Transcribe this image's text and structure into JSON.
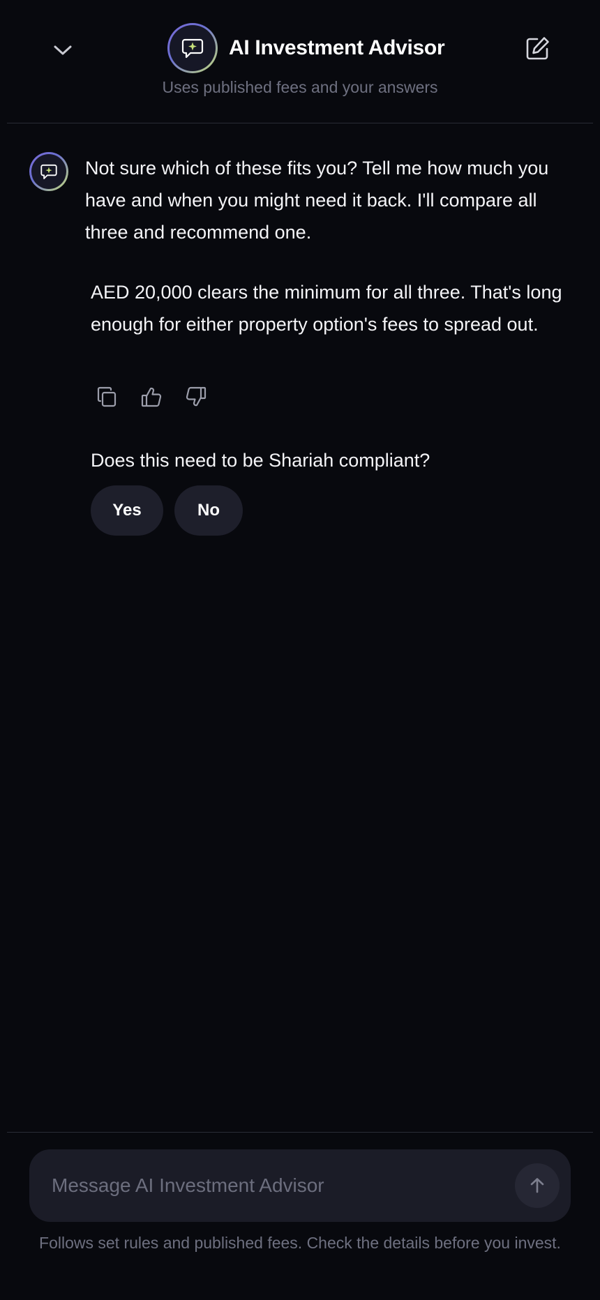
{
  "header": {
    "title": "AI Investment Advisor",
    "subtitle": "Uses published fees and your answers",
    "collapse_icon": "chevron-down-icon",
    "edit_icon": "edit-icon",
    "avatar_icon": "chat-sparkle-icon"
  },
  "messages": {
    "intro": "Not sure which of these fits you? Tell me how much you have and when you might need it back. I'll compare all three and recommend one.",
    "reply": "AED 20,000 clears the minimum for all three. That's long enough for either property option's fees to spread out.",
    "actions": [
      "copy-icon",
      "thumbs-up-icon",
      "thumbs-down-icon"
    ],
    "question": "Does this need to be Shariah compliant?",
    "options": {
      "yes": "Yes",
      "no": "No"
    }
  },
  "composer": {
    "placeholder": "Message AI Investment Advisor",
    "send_icon": "arrow-up-icon",
    "disclaimer": "Follows set rules and published fees. Check the details before you invest."
  },
  "colors": {
    "background": "#08090e",
    "chip": "#1e1f2b",
    "input": "#1b1c27",
    "accent_purple": "#7b6cd9",
    "accent_lime": "#c7e07a"
  }
}
